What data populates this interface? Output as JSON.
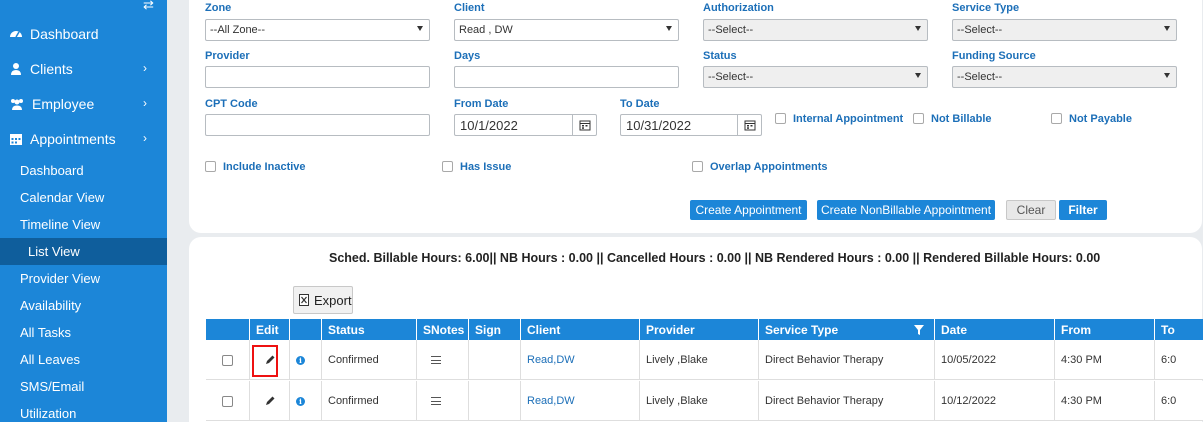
{
  "sidebar": {
    "main": [
      {
        "label": "Dashboard",
        "icon": "dashboard-icon",
        "chevron": false
      },
      {
        "label": "Clients",
        "icon": "user-icon",
        "chevron": true
      },
      {
        "label": "Employee",
        "icon": "users-icon",
        "chevron": true
      },
      {
        "label": "Appointments",
        "icon": "calendar-icon",
        "chevron": true
      }
    ],
    "sub": [
      {
        "label": "Dashboard"
      },
      {
        "label": "Calendar View"
      },
      {
        "label": "Timeline View"
      },
      {
        "label": "List View",
        "active": true
      },
      {
        "label": "Provider View"
      },
      {
        "label": "Availability"
      },
      {
        "label": "All Tasks"
      },
      {
        "label": "All Leaves"
      },
      {
        "label": "SMS/Email"
      },
      {
        "label": "Utilization"
      }
    ]
  },
  "filters": {
    "zone": {
      "label": "Zone",
      "value": "--All Zone--"
    },
    "client": {
      "label": "Client",
      "value": "Read , DW"
    },
    "authorization": {
      "label": "Authorization",
      "value": "--Select--"
    },
    "service_type": {
      "label": "Service Type",
      "value": "--Select--"
    },
    "provider": {
      "label": "Provider",
      "value": ""
    },
    "days": {
      "label": "Days",
      "value": ""
    },
    "status": {
      "label": "Status",
      "value": "--Select--"
    },
    "funding_source": {
      "label": "Funding Source",
      "value": "--Select--"
    },
    "cpt_code": {
      "label": "CPT Code",
      "value": ""
    },
    "from_date": {
      "label": "From Date",
      "value": "10/1/2022"
    },
    "to_date": {
      "label": "To Date",
      "value": "10/31/2022"
    },
    "checkboxes": {
      "internal_appointment": "Internal Appointment",
      "not_billable": "Not Billable",
      "not_payable": "Not Payable",
      "include_inactive": "Include Inactive",
      "has_issue": "Has Issue",
      "overlap_appointments": "Overlap Appointments"
    }
  },
  "buttons": {
    "create_appointment": "Create Appointment",
    "create_nonbillable": "Create NonBillable Appointment",
    "clear": "Clear",
    "filter": "Filter",
    "export": "Export"
  },
  "summary": "Sched. Billable Hours: 6.00|| NB Hours : 0.00 || Cancelled Hours : 0.00 || NB Rendered Hours : 0.00 || Rendered Billable Hours: 0.00",
  "table": {
    "headers": [
      "",
      "Edit",
      "",
      "Status",
      "SNotes",
      "Sign",
      "Client",
      "Provider",
      "Service Type",
      "Date",
      "From",
      "To"
    ],
    "rows": [
      {
        "status": "Confirmed",
        "client": "Read,DW",
        "provider": "Lively ,Blake",
        "service_type": "Direct Behavior Therapy",
        "date": "10/05/2022",
        "from": "4:30 PM",
        "to": "6:0"
      },
      {
        "status": "Confirmed",
        "client": "Read,DW",
        "provider": "Lively ,Blake",
        "service_type": "Direct Behavior Therapy",
        "date": "10/12/2022",
        "from": "4:30 PM",
        "to": "6:0"
      }
    ]
  },
  "colors": {
    "accent": "#1c86d8",
    "active_nav": "#0f5e9c",
    "label": "#1c6fb8",
    "highlight": "#e11111"
  }
}
